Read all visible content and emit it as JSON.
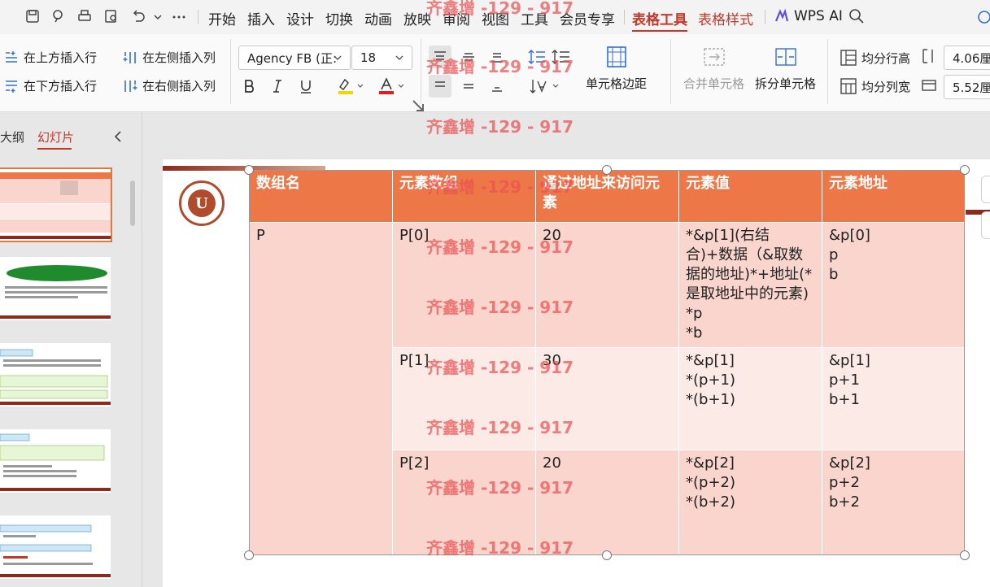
{
  "menu": {
    "items": [
      "开始",
      "插入",
      "设计",
      "切换",
      "动画",
      "放映",
      "审阅",
      "视图",
      "工具",
      "会员专享"
    ],
    "active_tab": "表格工具",
    "extra_tab": "表格样式",
    "ai_label": "WPS AI"
  },
  "ribbon": {
    "insert_above": "在上方插入行",
    "insert_below": "在下方插入行",
    "insert_left": "在左侧插入列",
    "insert_right": "在右侧插入列",
    "font_name": "Agency FB (正:",
    "font_size": "18",
    "cell_margin": "单元格边距",
    "merge_cells": "合并单元格",
    "split_cells": "拆分单元格",
    "distribute_rows": "均分行高",
    "distribute_cols": "均分列宽",
    "row_height": "4.06厘",
    "col_width": "5.52厘"
  },
  "left_panel": {
    "tab_outline": "大纲",
    "tab_slides": "幻灯片"
  },
  "table": {
    "headers": [
      "数组名",
      "元素数组",
      "通过地址来访问元素",
      "元素值",
      "元素地址"
    ],
    "array_name": "P",
    "rows": [
      {
        "element": "P[0]",
        "value": "20",
        "access": [
          "*&p[1](右结合)+数据（&取数据的地址)*+地址(*是取地址中的元素)",
          "*p",
          "*b"
        ],
        "address": [
          "&p[0]",
          "p",
          "b"
        ]
      },
      {
        "element": "P[1]",
        "value": "30",
        "access": [
          "*&p[1]",
          "*(p+1)",
          "*(b+1)"
        ],
        "address": [
          "&p[1]",
          "p+1",
          "b+1"
        ]
      },
      {
        "element": "P[2]",
        "value": "20",
        "access": [
          "*&p[2]",
          "*(p+2)",
          "*(b+2)"
        ],
        "address": [
          "&p[2]",
          "p+2",
          "b+2"
        ]
      }
    ]
  },
  "watermark": "齐鑫增 -129 - 917",
  "colors": {
    "header": "#ee7748",
    "row_dark": "#f9d5ce",
    "row_light": "#fceae6",
    "accent": "#c0392b"
  }
}
